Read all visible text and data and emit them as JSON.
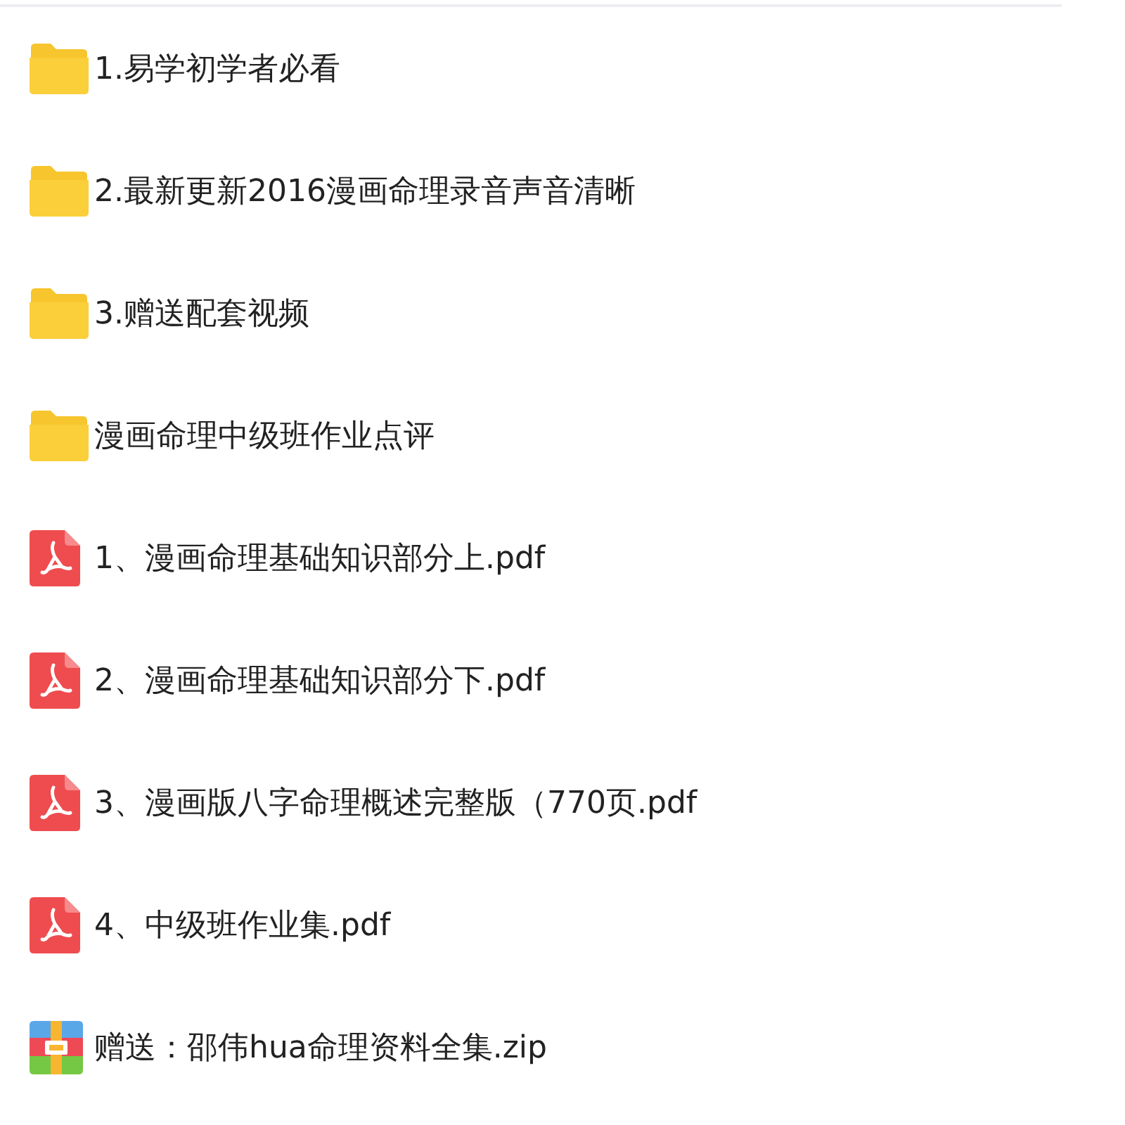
{
  "files": [
    {
      "kind": "folder",
      "name": "1.易学初学者必看"
    },
    {
      "kind": "folder",
      "name": "2.最新更新2016漫画命理录音声音清晰"
    },
    {
      "kind": "folder",
      "name": "3.赠送配套视频"
    },
    {
      "kind": "folder",
      "name": "漫画命理中级班作业点评"
    },
    {
      "kind": "pdf",
      "name": "1、漫画命理基础知识部分上.pdf"
    },
    {
      "kind": "pdf",
      "name": "2、漫画命理基础知识部分下.pdf"
    },
    {
      "kind": "pdf",
      "name": "3、漫画版八字命理概述完整版（770页.pdf"
    },
    {
      "kind": "pdf",
      "name": "4、中级班作业集.pdf"
    },
    {
      "kind": "zip",
      "name": "赠送：邵伟hua命理资料全集.zip"
    }
  ]
}
